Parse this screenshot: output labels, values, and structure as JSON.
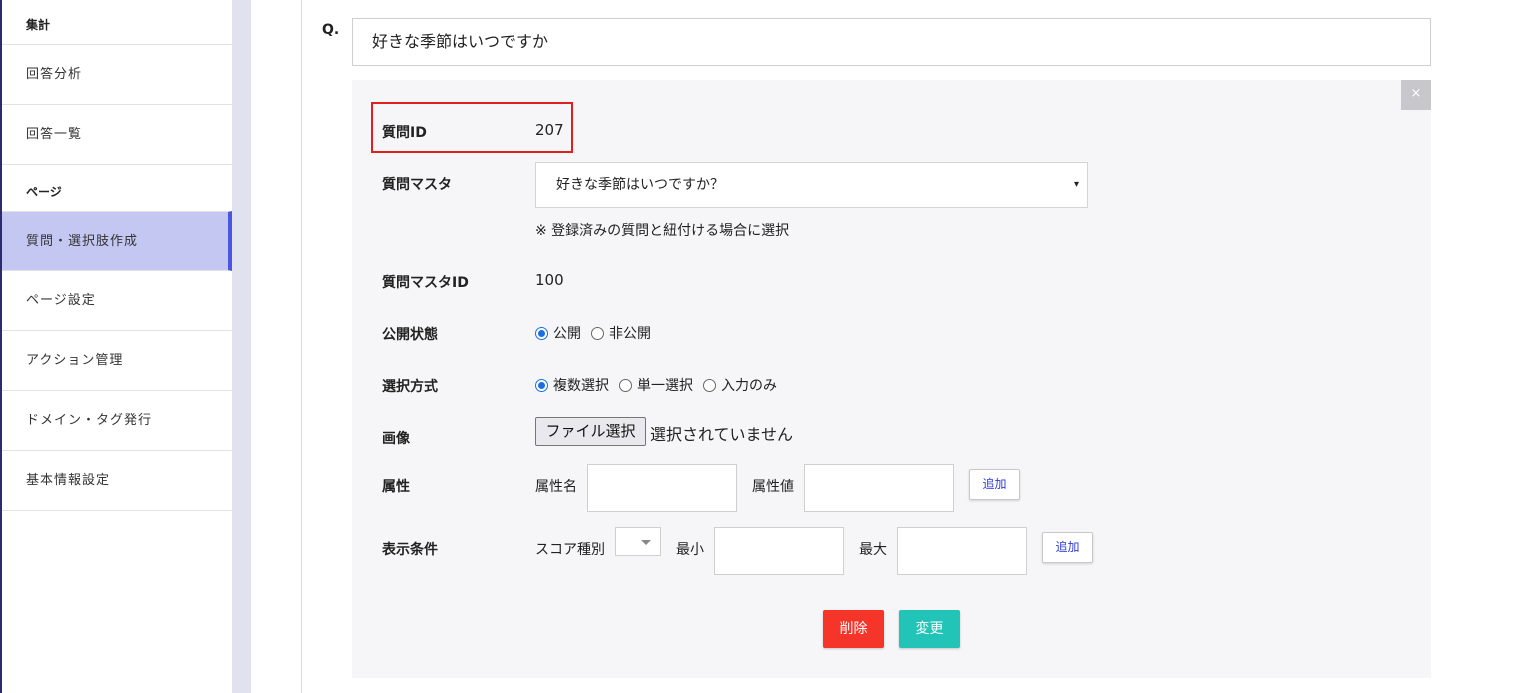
{
  "sidebar": {
    "section_aggregate": "集計",
    "aggregate_items": [
      "回答分析",
      "回答一覧"
    ],
    "section_page": "ページ",
    "page_items": [
      "質問・選択肢作成",
      "ページ設定",
      "アクション管理",
      "ドメイン・タグ発行",
      "基本情報設定"
    ]
  },
  "question": {
    "prefix": "Q.",
    "text": "好きな季節はいつですか"
  },
  "form": {
    "close_label": "×",
    "question_id_label": "質問ID",
    "question_id_value": "207",
    "master_label": "質問マスタ",
    "master_selected": "好きな季節はいつですか？",
    "master_arrow": "▾",
    "master_note": "※ 登録済みの質問と紐付ける場合に選択",
    "master_id_label": "質問マスタID",
    "master_id_value": "100",
    "publish_label": "公開状態",
    "publish_options": [
      "公開",
      "非公開"
    ],
    "publish_selected": "公開",
    "selection_label": "選択方式",
    "selection_options": [
      "複数選択",
      "単一選択",
      "入力のみ"
    ],
    "selection_selected": "複数選択",
    "image_label": "画像",
    "file_button": "ファイル選択",
    "file_status": "選択されていません",
    "attribute_label": "属性",
    "attribute_name_label": "属性名",
    "attribute_value_label": "属性値",
    "add_label": "追加",
    "display_label": "表示条件",
    "score_type_label": "スコア種別",
    "min_label": "最小",
    "max_label": "最大",
    "delete_label": "削除",
    "change_label": "変更"
  },
  "colors": {
    "highlight": "#e01f1f",
    "delete": "#f5352a",
    "change": "#23c4b8",
    "active_nav": "#c4c7f2",
    "active_bar": "#4a56e2"
  }
}
